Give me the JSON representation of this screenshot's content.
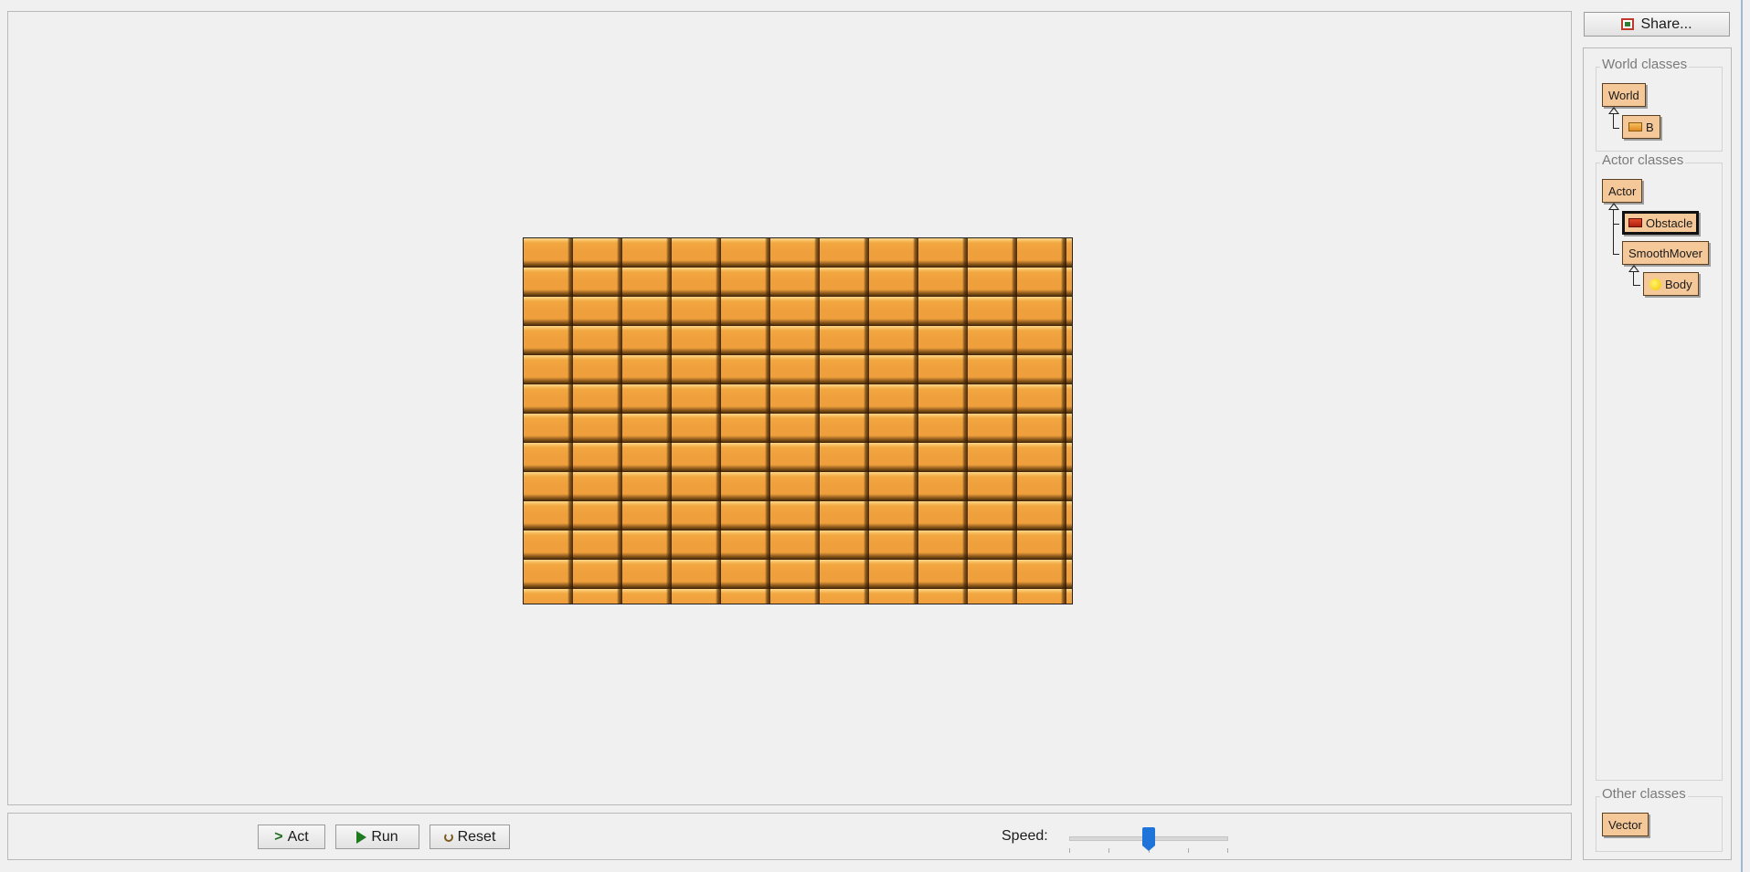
{
  "world_view": {
    "background_pattern": "orange-bricks",
    "brick_color": "#efa03c"
  },
  "controls": {
    "act_label": "Act",
    "run_label": "Run",
    "reset_label": "Reset",
    "speed_label": "Speed:",
    "speed_value": 0.5,
    "slider_color": "#1f74d9"
  },
  "share": {
    "label": "Share..."
  },
  "classes": {
    "world_group_title": "World classes",
    "world_root": "World",
    "world_subclass": "B",
    "actor_group_title": "Actor classes",
    "actor_root": "Actor",
    "obstacle": "Obstacle",
    "smooth_mover": "SmoothMover",
    "body": "Body",
    "other_group_title": "Other classes",
    "vector": "Vector",
    "class_color": "#f5c89a"
  }
}
